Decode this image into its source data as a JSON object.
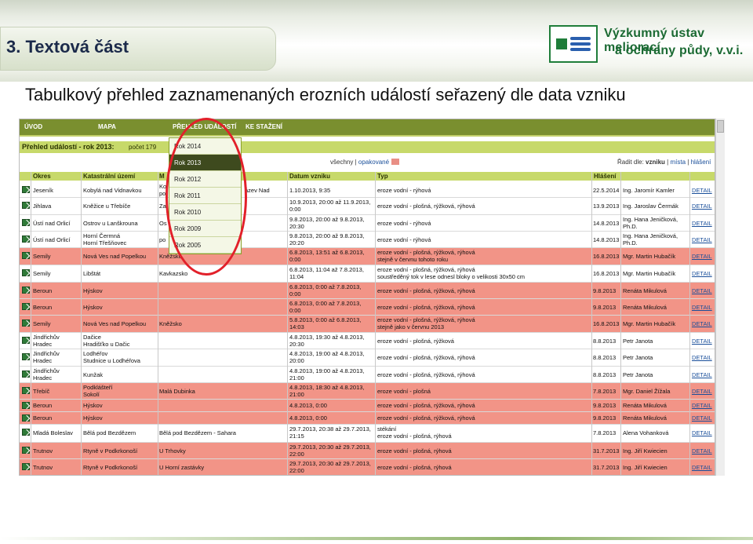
{
  "slide": {
    "title": "3. Textová část",
    "org_line1": "Výzkumný ústav meliorací",
    "org_line2": "a ochrany půdy, v.v.i.",
    "subtitle": "Tabulkový přehled zaznamenaných erozních událostí seřazený dle data vzniku"
  },
  "nav": [
    "ÚVOD",
    "MAPA",
    "PŘEHLED UDÁLOSTÍ",
    "KE STAŽENÍ"
  ],
  "header": {
    "title": "Přehled událostí - rok 2013:",
    "count": "počet 179"
  },
  "filter": {
    "label": "všechny",
    "sep": " | ",
    "link": "opakované"
  },
  "sort": {
    "label": "Řadit dle:",
    "current": "vzniku",
    "opt1": "místa",
    "opt2": "hlášení"
  },
  "columns": [
    "Okres",
    "Katastrální území",
    "M",
    "Datum vzniku",
    "Typ",
    "Hlášení"
  ],
  "dropdown": {
    "items": [
      "Rok 2014",
      "Rok 2013",
      "Rok 2012",
      "Rok 2011",
      "Rok 2010",
      "Rok 2009",
      "Rok 2005"
    ],
    "selected": "Rok 2013"
  },
  "detail_label": "DETAIL",
  "rows": [
    {
      "red": false,
      "okres": "Jeseník",
      "ku": "Kobylá nad Vidnavkou",
      "misto": "Ko\npo",
      "misto2": "ázev Nad",
      "datum": "1.10.2013, 9:35",
      "typ": "eroze vodní - rýhová",
      "hdate": "22.5.2014",
      "hname": "Ing. Jaromír Kamler"
    },
    {
      "red": false,
      "okres": "Jihlava",
      "ku": "Kněžice u Třebíče",
      "misto": "Za",
      "misto2": "",
      "datum": "10.9.2013, 20:00 až 11.9.2013,\n0:00",
      "typ": "eroze vodní - plošná, rýžková, rýhová",
      "hdate": "13.9.2013",
      "hname": "Ing. Jaroslav Čermák"
    },
    {
      "red": false,
      "okres": "Ústí nad Orlicí",
      "ku": "Ostrov u Lanškrouna",
      "misto": "Os",
      "misto2": "",
      "datum": "9.8.2013, 20:00 až 9.8.2013,\n20:30",
      "typ": "eroze vodní - rýhová",
      "hdate": "14.8.2013",
      "hname": "Ing. Hana Jeničková,\nPh.D."
    },
    {
      "red": false,
      "okres": "Ústí nad Orlicí",
      "ku": "Horní Čermná\nHorní Třešňovec",
      "misto": "po",
      "misto2": "",
      "datum": "9.8.2013, 20:00 až 9.8.2013,\n20:20",
      "typ": "eroze vodní - rýhová",
      "hdate": "14.8.2013",
      "hname": "Ing. Hana Jeničková,\nPh.D."
    },
    {
      "red": true,
      "okres": "Semily",
      "ku": "Nová Ves nad Popelkou",
      "misto": "Kněžsko",
      "misto2": "",
      "datum": "6.8.2013, 13:51 až 6.8.2013,\n0:00",
      "typ": "eroze vodní - plošná, rýžková, rýhová\nstejně v červnu tohoto roku",
      "hdate": "16.8.2013",
      "hname": "Mgr. Martin Hubačík"
    },
    {
      "red": false,
      "okres": "Semily",
      "ku": "Libštát",
      "misto": "Kavkazsko",
      "misto2": "",
      "datum": "6.8.2013, 11:04 až 7.8.2013,\n11:04",
      "typ": "eroze vodní - plošná, rýžková, rýhová\nsoustředěný tok v lese odnesl bloky o velikosti 30x50 cm",
      "hdate": "16.8.2013",
      "hname": "Mgr. Martin Hubačík"
    },
    {
      "red": true,
      "okres": "Beroun",
      "ku": "Hýskov",
      "misto": "",
      "misto2": "",
      "datum": "6.8.2013, 0:00 až 7.8.2013,\n0:00",
      "typ": "eroze vodní - plošná, rýžková, rýhová",
      "hdate": "9.8.2013",
      "hname": "Renáta Mikulová"
    },
    {
      "red": true,
      "okres": "Beroun",
      "ku": "Hýskov",
      "misto": "",
      "misto2": "",
      "datum": "6.8.2013, 0:00 až 7.8.2013,\n0:00",
      "typ": "eroze vodní - plošná, rýžková, rýhová",
      "hdate": "9.8.2013",
      "hname": "Renáta Mikulová"
    },
    {
      "red": true,
      "okres": "Semily",
      "ku": "Nová Ves nad Popelkou",
      "misto": "Kněžsko",
      "misto2": "",
      "datum": "5.8.2013, 0:00 až 6.8.2013,\n14:03",
      "typ": "eroze vodní - plošná, rýžková, rýhová\nstejně jako v červnu 2013",
      "hdate": "16.8.2013",
      "hname": "Mgr. Martin Hubačík"
    },
    {
      "red": false,
      "okres": "Jindřichův\nHradec",
      "ku": "Dačice\nHradišťko u Dačic",
      "misto": "",
      "misto2": "",
      "datum": "4.8.2013, 19:30 až 4.8.2013,\n20:30",
      "typ": "eroze vodní - plošná, rýžková",
      "hdate": "8.8.2013",
      "hname": "Petr Janota"
    },
    {
      "red": false,
      "okres": "Jindřichův\nHradec",
      "ku": "Lodhéřov\nStudnice u Lodhéřova",
      "misto": "",
      "misto2": "",
      "datum": "4.8.2013, 19:00 až 4.8.2013,\n20:00",
      "typ": "eroze vodní - plošná, rýžková, rýhová",
      "hdate": "8.8.2013",
      "hname": "Petr Janota"
    },
    {
      "red": false,
      "okres": "Jindřichův\nHradec",
      "ku": "Kunžak",
      "misto": "",
      "misto2": "",
      "datum": "4.8.2013, 19:00 až 4.8.2013,\n21:00",
      "typ": "eroze vodní - plošná, rýžková, rýhová",
      "hdate": "8.8.2013",
      "hname": "Petr Janota"
    },
    {
      "red": true,
      "okres": "Třebíč",
      "ku": "Podklášteří\nSokolí",
      "misto": "Malá Dubinka",
      "misto2": "",
      "datum": "4.8.2013, 18:30 až 4.8.2013,\n21:00",
      "typ": "eroze vodní - plošná",
      "hdate": "7.8.2013",
      "hname": "Mgr. Daniel Žížala"
    },
    {
      "red": true,
      "okres": "Beroun",
      "ku": "Hýskov",
      "misto": "",
      "misto2": "",
      "datum": "4.8.2013, 0:00",
      "typ": "eroze vodní - plošná, rýžková, rýhová",
      "hdate": "9.8.2013",
      "hname": "Renáta Mikulová"
    },
    {
      "red": true,
      "okres": "Beroun",
      "ku": "Hýskov",
      "misto": "",
      "misto2": "",
      "datum": "4.8.2013, 0:00",
      "typ": "eroze vodní - plošná, rýžková, rýhová",
      "hdate": "9.8.2013",
      "hname": "Renáta Mikulová"
    },
    {
      "red": false,
      "okres": "Mladá Boleslav",
      "ku": "Bělá pod Bezdězem",
      "misto": "Bělá pod Bezdězem - Sahara",
      "misto2": "",
      "datum": "29.7.2013, 20:38 až 29.7.2013,\n21:15",
      "typ": "stékání\neroze vodní - plošná, rýhová",
      "hdate": "7.8.2013",
      "hname": "Alena Vohanková"
    },
    {
      "red": true,
      "okres": "Trutnov",
      "ku": "Rtyně v Podkrkonoší",
      "misto": "U Trhovky",
      "misto2": "",
      "datum": "29.7.2013, 20:30 až 29.7.2013,\n22:00",
      "typ": "eroze vodní - plošná, rýhová",
      "hdate": "31.7.2013",
      "hname": "Ing. Jiří Kwiecien"
    },
    {
      "red": true,
      "okres": "Trutnov",
      "ku": "Rtyně v Podkrkonoší",
      "misto": "U Horní zastávky",
      "misto2": "",
      "datum": "29.7.2013, 20:30 až 29.7.2013,\n22:00",
      "typ": "eroze vodní - plošná, rýhová",
      "hdate": "31.7.2013",
      "hname": "Ing. Jiří Kwiecien"
    }
  ]
}
